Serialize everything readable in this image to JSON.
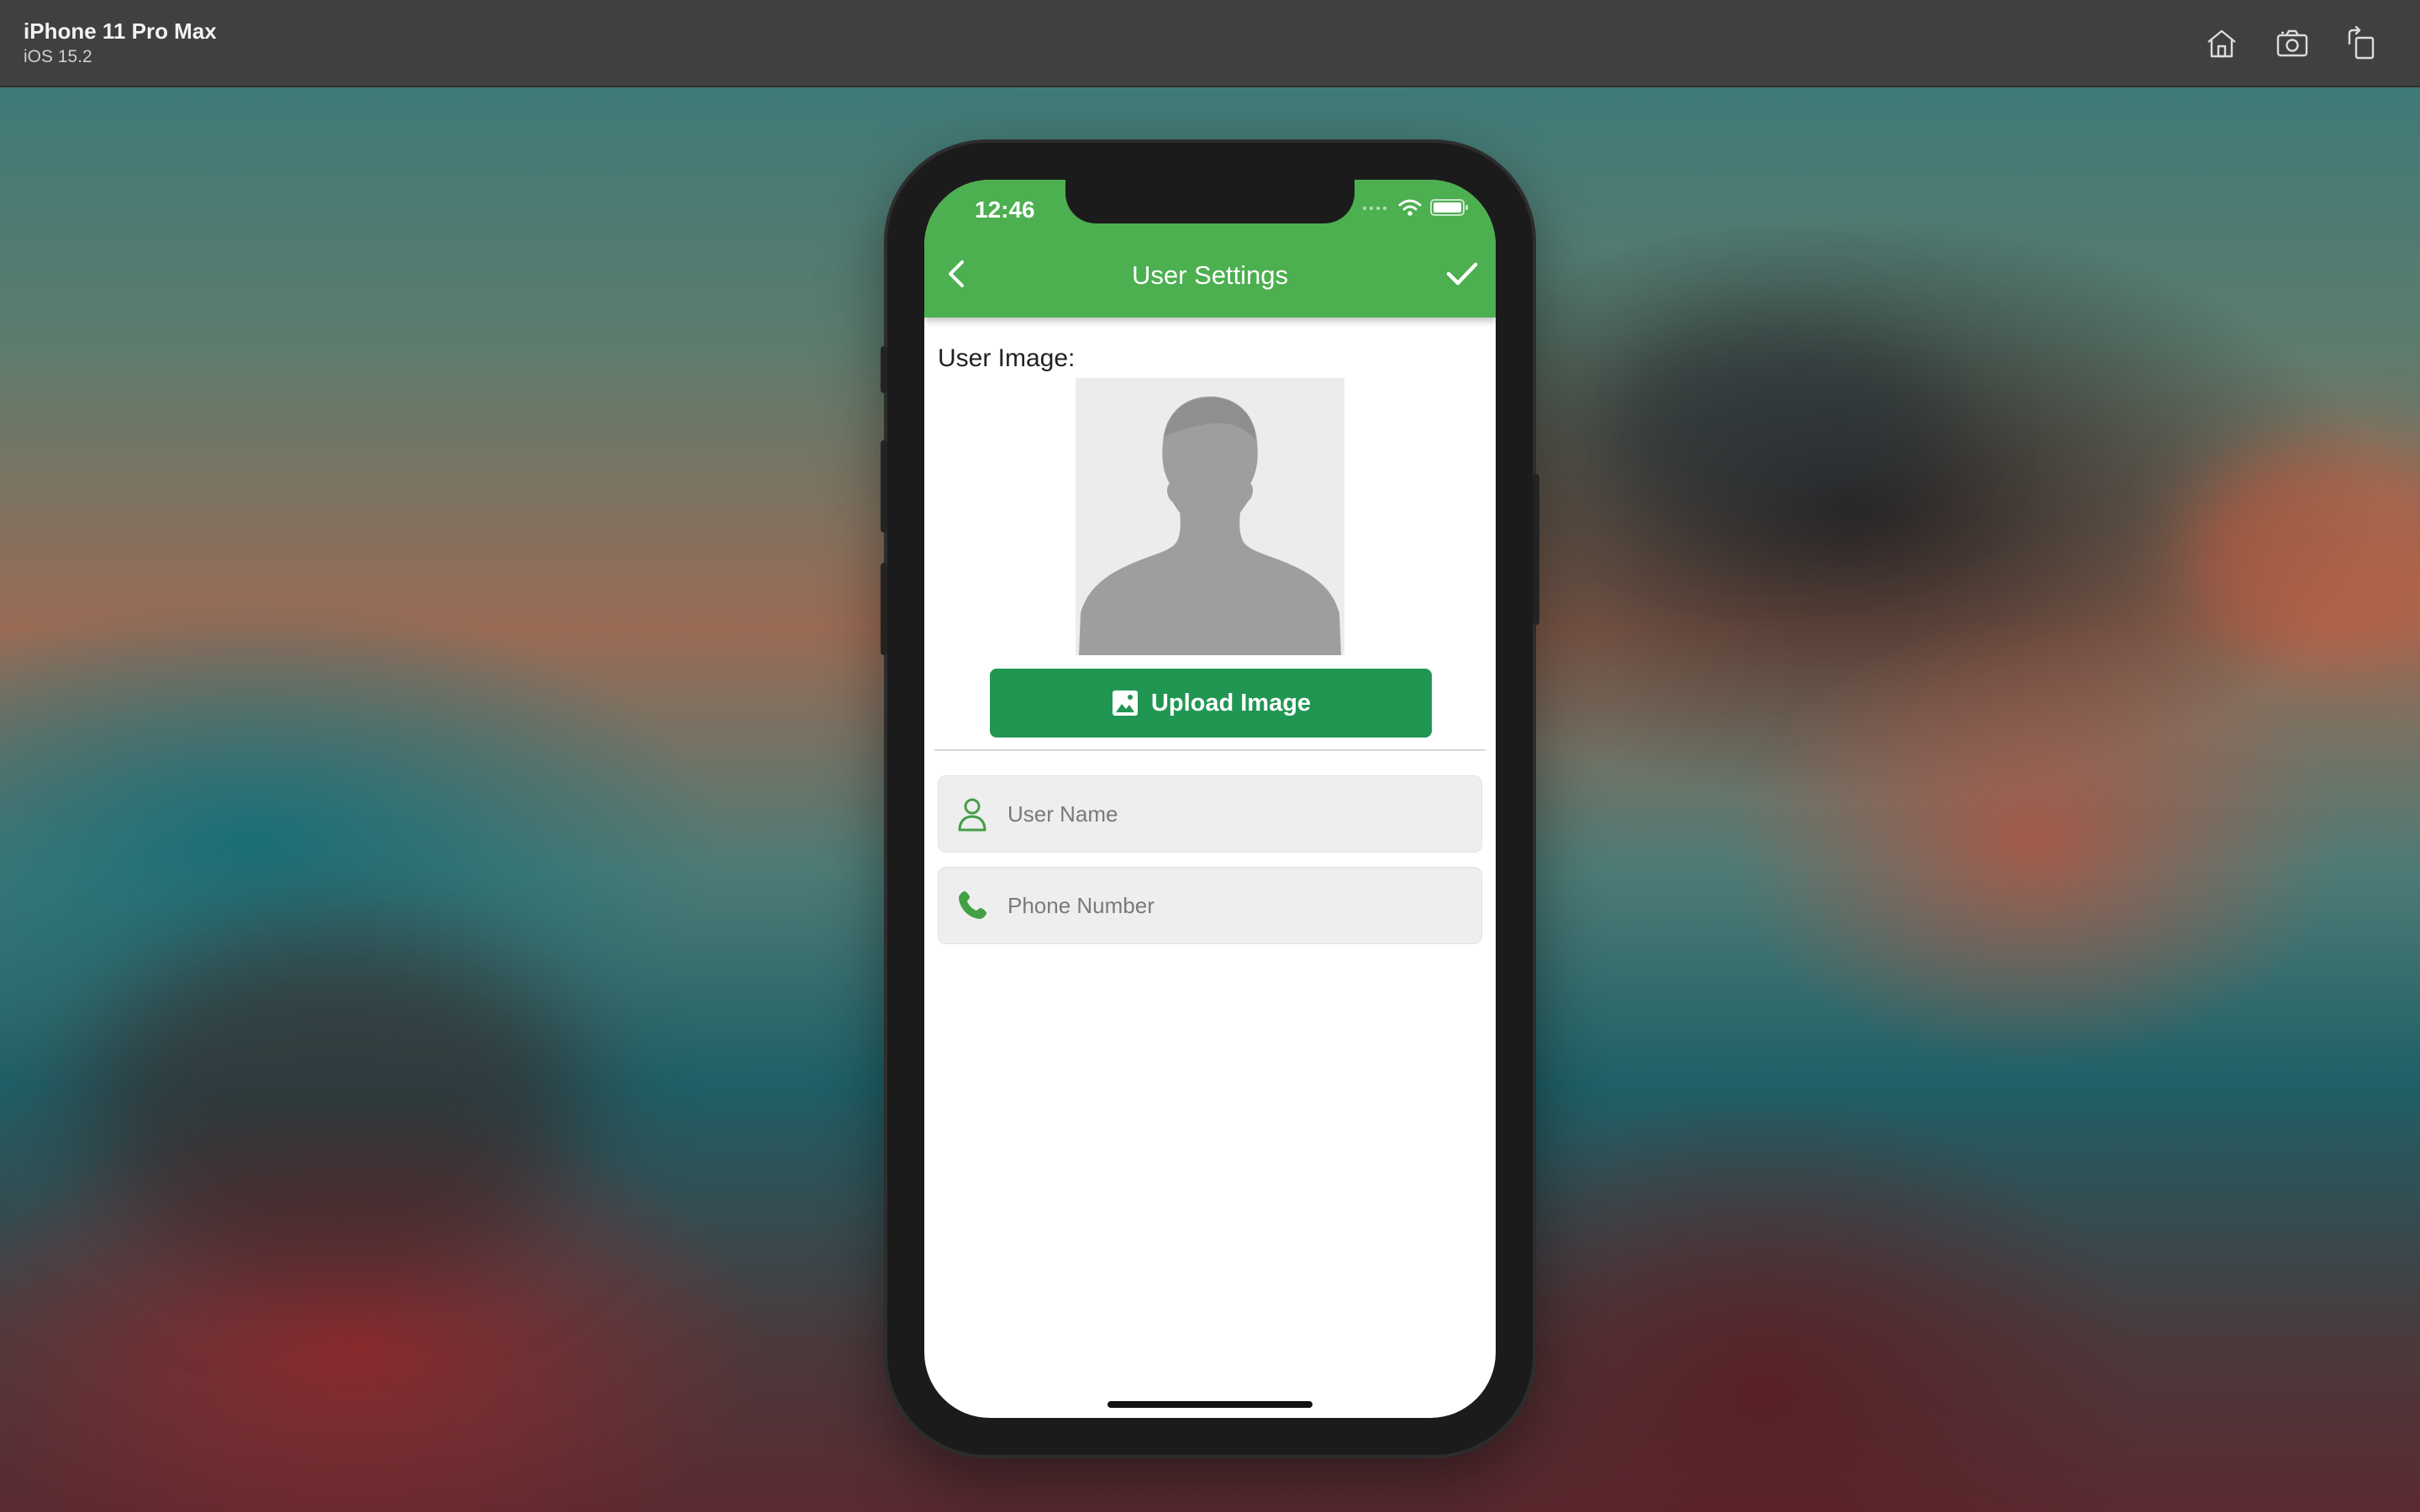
{
  "simulator": {
    "device_name": "iPhone 11 Pro Max",
    "os_version": "iOS 15.2",
    "toolbar_icons": [
      "home-icon",
      "screenshot-icon",
      "rotate-icon"
    ]
  },
  "status_bar": {
    "time": "12:46"
  },
  "nav_bar": {
    "title": "User Settings",
    "back_icon": "chevron-left-icon",
    "save_icon": "checkmark-icon"
  },
  "user_image": {
    "label": "User Image:",
    "upload_label": "Upload Image"
  },
  "fields": {
    "user_name": {
      "placeholder": "User Name",
      "value": ""
    },
    "phone_number": {
      "placeholder": "Phone Number",
      "value": ""
    }
  },
  "colors": {
    "header_green": "#4caf50",
    "button_green": "#219653",
    "icon_green": "#43a047"
  }
}
